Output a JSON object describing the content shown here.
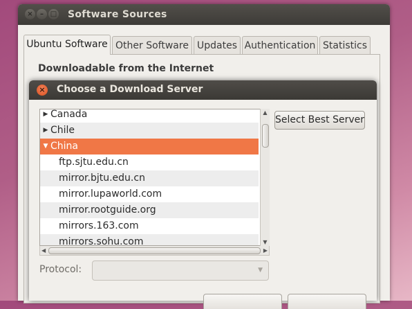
{
  "main_window": {
    "title": "Software Sources",
    "window_buttons": {
      "close": "×",
      "minimize": "–",
      "maximize": "□"
    },
    "tabs": [
      {
        "label": "Ubuntu Software",
        "active": true
      },
      {
        "label": "Other Software",
        "active": false
      },
      {
        "label": "Updates",
        "active": false
      },
      {
        "label": "Authentication",
        "active": false
      },
      {
        "label": "Statistics",
        "active": false
      }
    ],
    "section_heading": "Downloadable from the Internet"
  },
  "dialog": {
    "title": "Choose a Download Server",
    "close_glyph": "×",
    "server_list": [
      {
        "label": "Canada",
        "type": "country",
        "expander": "▶",
        "expanded": false
      },
      {
        "label": "Chile",
        "type": "country",
        "expander": "▶",
        "expanded": false
      },
      {
        "label": "China",
        "type": "country",
        "expander": "▼",
        "expanded": true,
        "selected": true
      },
      {
        "label": "ftp.sjtu.edu.cn",
        "type": "mirror"
      },
      {
        "label": "mirror.bjtu.edu.cn",
        "type": "mirror"
      },
      {
        "label": "mirror.lupaworld.com",
        "type": "mirror"
      },
      {
        "label": "mirror.rootguide.org",
        "type": "mirror"
      },
      {
        "label": "mirrors.163.com",
        "type": "mirror"
      },
      {
        "label": "mirrors.sohu.com",
        "type": "mirror"
      }
    ],
    "select_best_button": "Select Best Server",
    "protocol_label": "Protocol:",
    "protocol_value": "",
    "scroll_arrows": {
      "up": "▲",
      "down": "▼",
      "left": "◀",
      "right": "▶"
    },
    "combo_arrow": "▼"
  },
  "colors": {
    "selection": "#f07746",
    "titlebar": "#3d3b37",
    "close_button": "#e2582a"
  }
}
